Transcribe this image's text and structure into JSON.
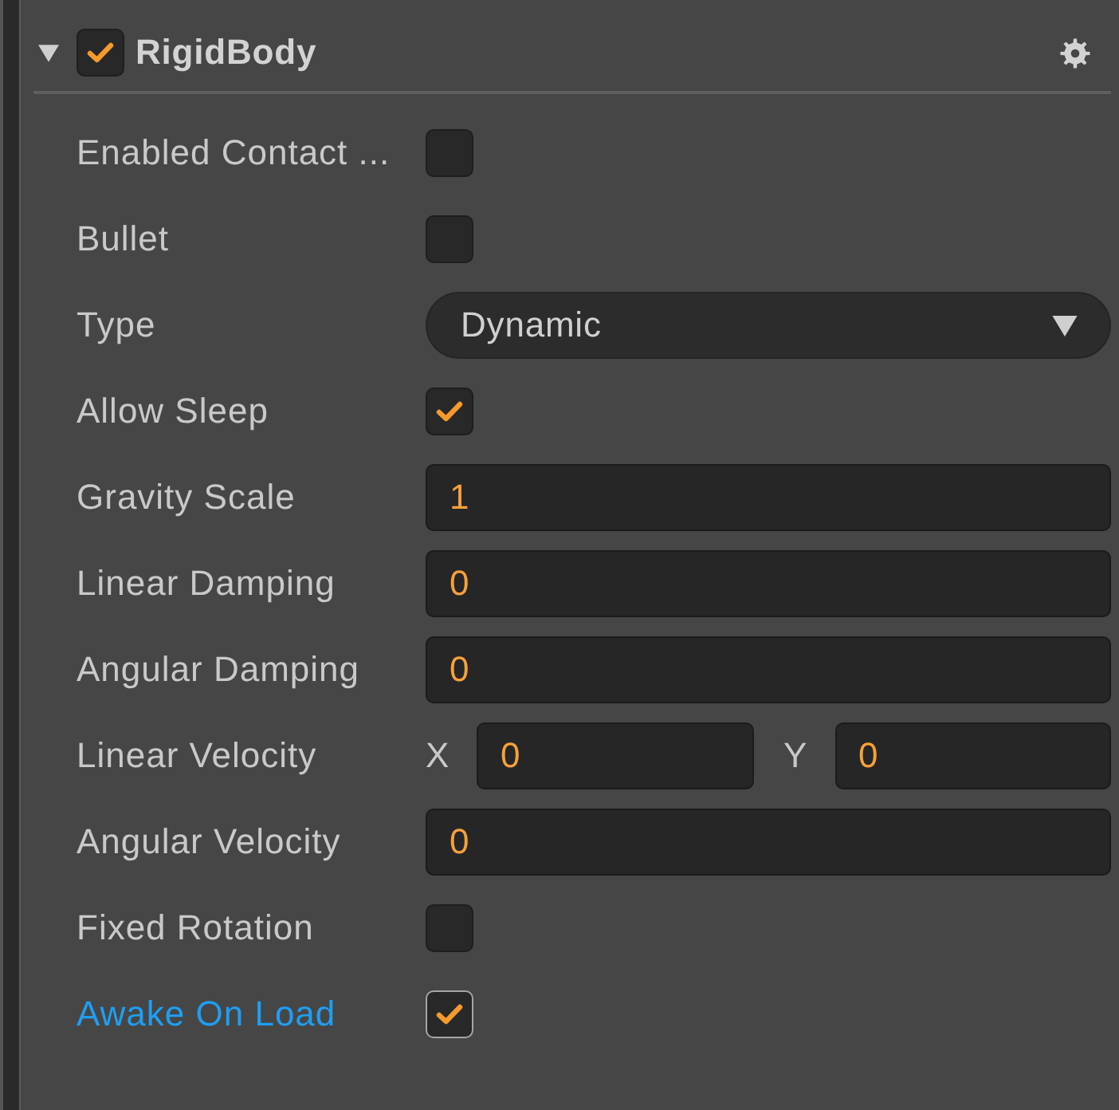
{
  "component": {
    "title": "RigidBody",
    "expanded": true,
    "enabled": true
  },
  "properties": [
    {
      "kind": "checkbox",
      "label": "Enabled Contact ...",
      "checked": false,
      "highlighted": false
    },
    {
      "kind": "checkbox",
      "label": "Bullet",
      "checked": false,
      "highlighted": false
    },
    {
      "kind": "dropdown",
      "label": "Type",
      "value": "Dynamic",
      "highlighted": false
    },
    {
      "kind": "checkbox",
      "label": "Allow Sleep",
      "checked": true,
      "highlighted": false
    },
    {
      "kind": "number",
      "label": "Gravity Scale",
      "value": "1",
      "highlighted": false
    },
    {
      "kind": "number",
      "label": "Linear Damping",
      "value": "0",
      "highlighted": false
    },
    {
      "kind": "number",
      "label": "Angular Damping",
      "value": "0",
      "highlighted": false
    },
    {
      "kind": "vector",
      "label": "Linear Velocity",
      "components": [
        {
          "axis": "X",
          "value": "0"
        },
        {
          "axis": "Y",
          "value": "0"
        }
      ],
      "highlighted": false
    },
    {
      "kind": "number",
      "label": "Angular Velocity",
      "value": "0",
      "highlighted": false
    },
    {
      "kind": "checkbox",
      "label": "Fixed Rotation",
      "checked": false,
      "highlighted": false
    },
    {
      "kind": "checkbox",
      "label": "Awake On Load",
      "checked": true,
      "highlighted": true
    }
  ]
}
